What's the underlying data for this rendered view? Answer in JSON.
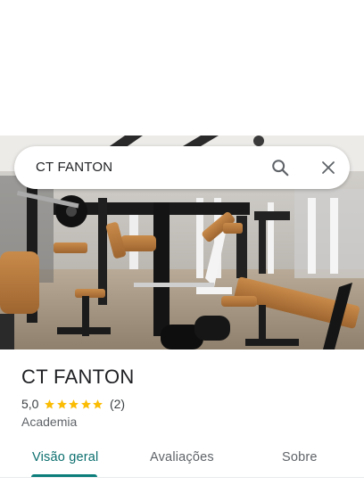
{
  "search": {
    "query": "CT FANTON"
  },
  "place": {
    "name": "CT FANTON",
    "rating": "5,0",
    "stars": 5,
    "review_count": "(2)",
    "category": "Academia"
  },
  "tabs": [
    {
      "label": "Visão geral",
      "active": true
    },
    {
      "label": "Avaliações",
      "active": false
    },
    {
      "label": "Sobre",
      "active": false
    }
  ],
  "colors": {
    "accent": "#0b7d7a",
    "star": "#fbbc04",
    "text_primary": "#202124",
    "text_secondary": "#5f6368"
  },
  "icons": [
    "search-icon",
    "close-icon",
    "star-icon"
  ]
}
